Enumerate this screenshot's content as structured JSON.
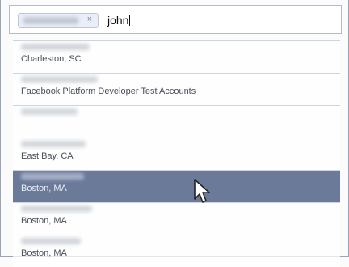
{
  "search": {
    "query": "john",
    "token_remove": "×"
  },
  "results": [
    {
      "subtitle": "Charleston, SC"
    },
    {
      "subtitle": "Facebook Platform Developer Test Accounts"
    },
    {
      "subtitle": ""
    },
    {
      "subtitle": "East Bay, CA"
    },
    {
      "subtitle": "Boston, MA"
    },
    {
      "subtitle": "Boston, MA"
    },
    {
      "subtitle": "Boston, MA"
    }
  ],
  "colors": {
    "highlight": "#6b7a99",
    "border": "#9aa4b8"
  },
  "icons": {
    "remove_token": "close-icon",
    "mouse_cursor": "arrow-cursor-icon"
  }
}
